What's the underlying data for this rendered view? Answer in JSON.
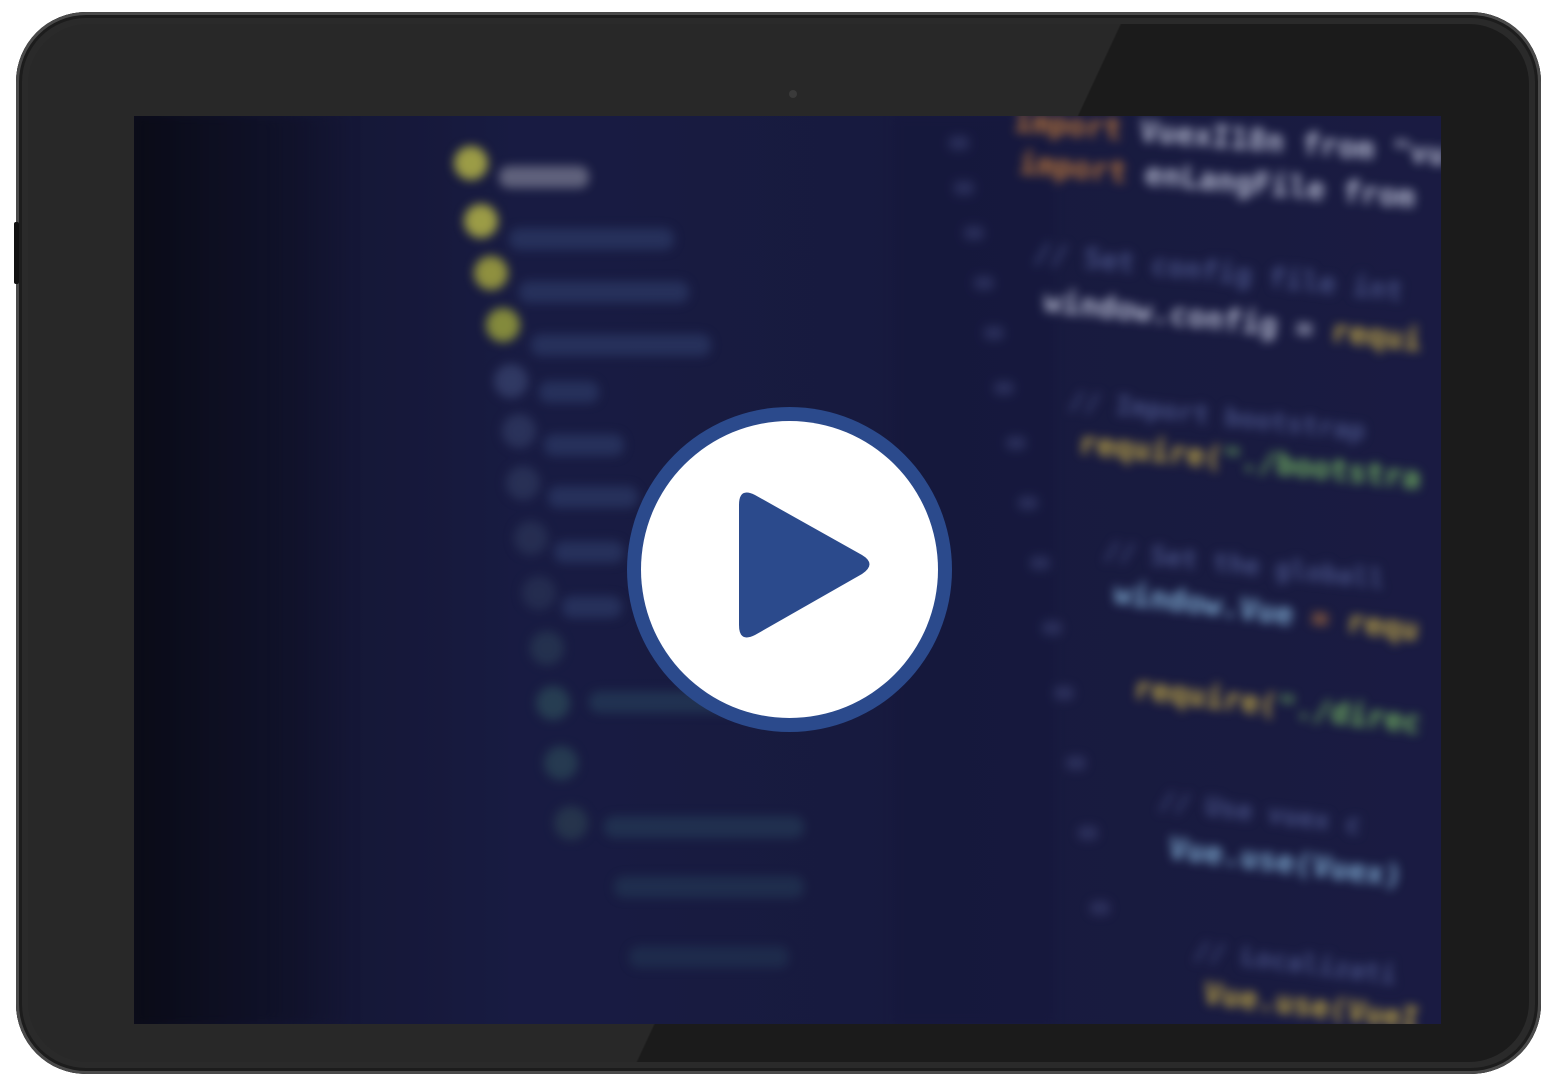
{
  "screen": {
    "code_lines": [
      {
        "tokens": [
          {
            "text": "import ",
            "tone": "orange"
          },
          {
            "text": "VuexI18n",
            "tone": "white"
          },
          {
            "text": " from ",
            "tone": "white"
          },
          {
            "text": "\"vu",
            "tone": "white"
          }
        ]
      },
      {
        "tokens": [
          {
            "text": "import ",
            "tone": "orange"
          },
          {
            "text": "enLangFile",
            "tone": "white"
          },
          {
            "text": " from",
            "tone": "white"
          }
        ]
      },
      {
        "tokens": [
          {
            "text": "// Set config file int",
            "tone": "gray"
          }
        ]
      },
      {
        "tokens": [
          {
            "text": "window.config",
            "tone": "white"
          },
          {
            "text": " = ",
            "tone": "white"
          },
          {
            "text": "requi",
            "tone": "yellow"
          }
        ]
      },
      {
        "tokens": [
          {
            "text": "// Import bootstrap",
            "tone": "gray"
          }
        ]
      },
      {
        "tokens": [
          {
            "text": "require(",
            "tone": "yellow"
          },
          {
            "text": "\"./bootstra",
            "tone": "green"
          }
        ]
      },
      {
        "tokens": [
          {
            "text": "// Set the globall",
            "tone": "gray"
          }
        ]
      },
      {
        "tokens": [
          {
            "text": "window.Vue",
            "tone": "cyan"
          },
          {
            "text": " = ",
            "tone": "orange"
          },
          {
            "text": "requ",
            "tone": "yellow"
          }
        ]
      },
      {
        "tokens": [
          {
            "text": "require(",
            "tone": "yellow"
          },
          {
            "text": "\"./direc",
            "tone": "green"
          }
        ]
      },
      {
        "tokens": [
          {
            "text": "// Use vuex c",
            "tone": "gray"
          }
        ]
      },
      {
        "tokens": [
          {
            "text": "Vue.use(Vuex)",
            "tone": "cyan"
          }
        ]
      },
      {
        "tokens": [
          {
            "text": "// Localizati",
            "tone": "gray"
          }
        ]
      },
      {
        "tokens": [
          {
            "text": "Vue.use(VueI",
            "tone": "yellow"
          }
        ]
      }
    ]
  },
  "player": {
    "play_button_label": "Play video",
    "accent_color": "#2b4a8c"
  },
  "colors": {
    "bezel": "#2a2a2a",
    "screen_bg": "#1a1d45"
  }
}
